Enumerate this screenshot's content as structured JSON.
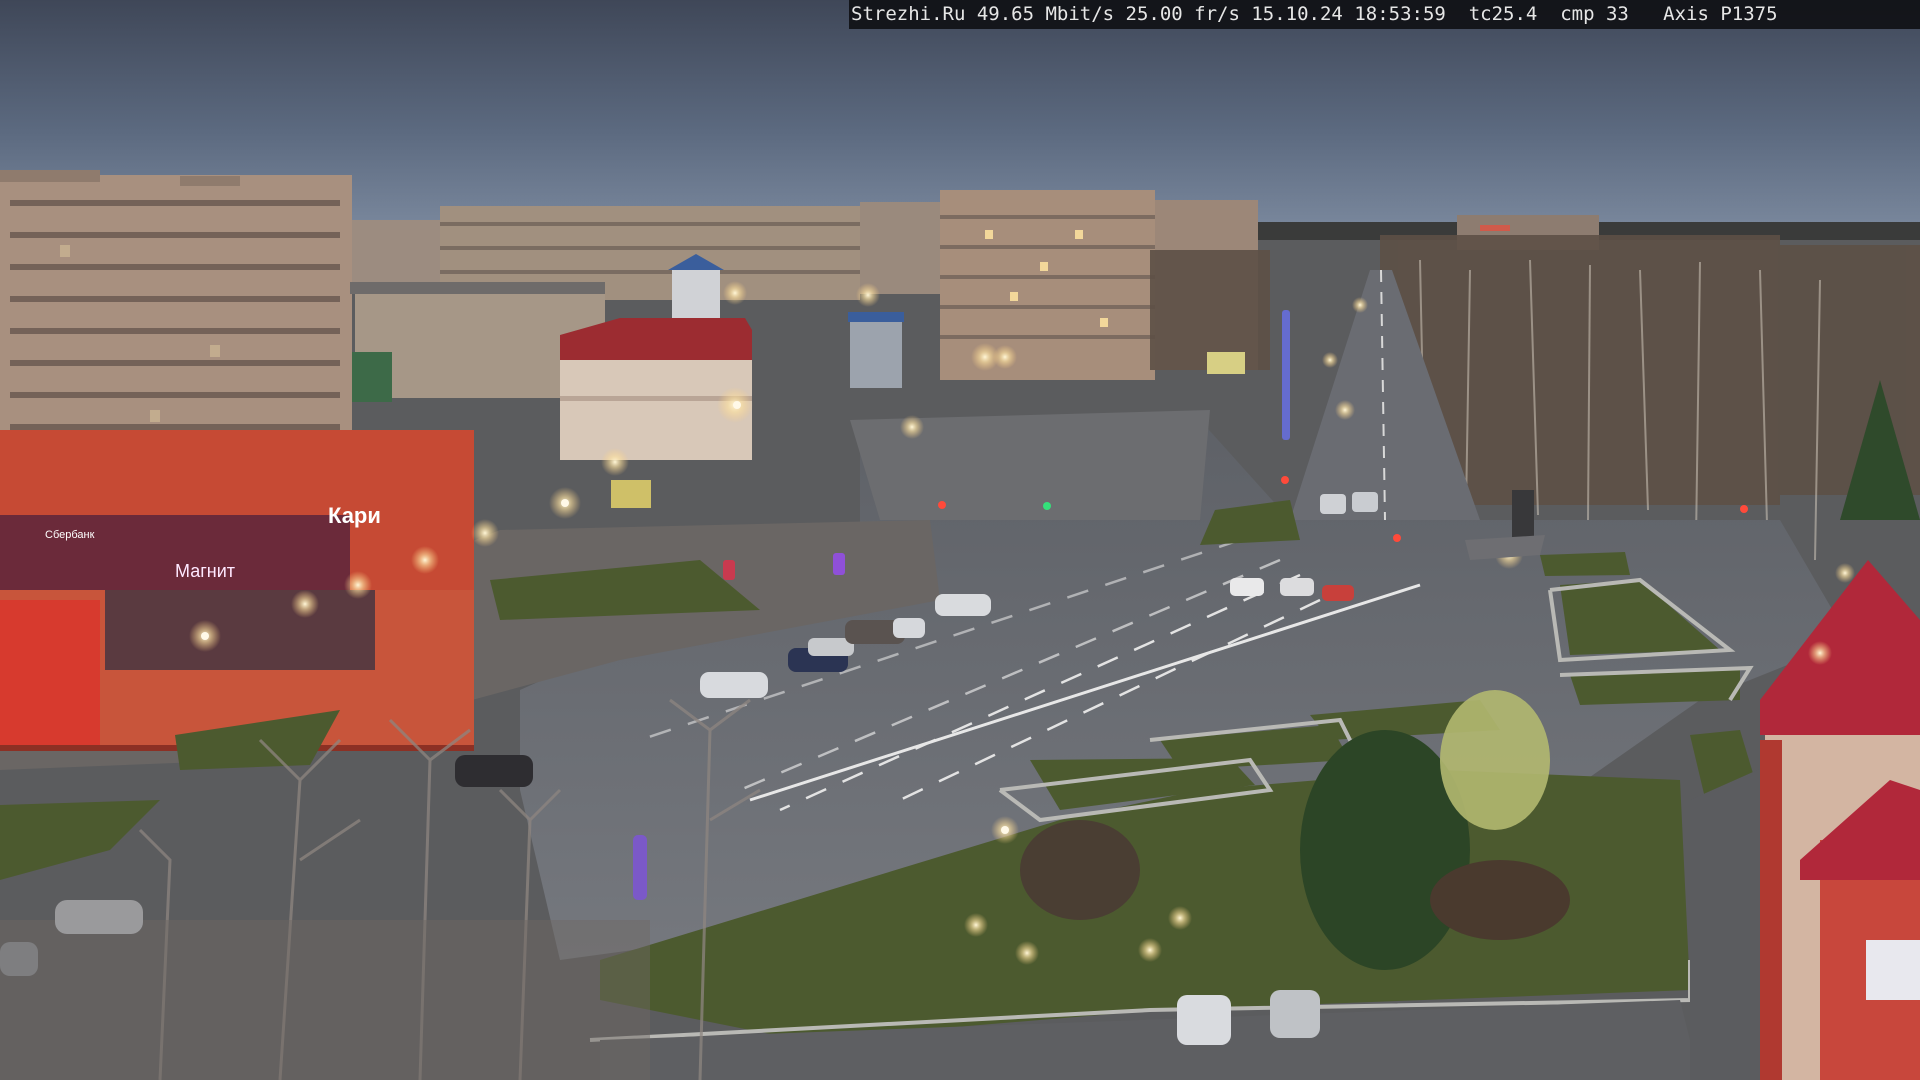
{
  "overlay": {
    "text": "Strezhi.Ru 49.65 Mbit/s 25.00 fr/s 15.10.24 18:53:59  tc25.4  cmp 33   Axis P1375"
  },
  "storefront": {
    "sign_main": "Кари",
    "sign_left": "Магнит",
    "bank_sign": "Сбербанк"
  },
  "colors": {
    "sky_top": "#4b5567",
    "sky_bottom": "#78879c",
    "asphalt": "#6d7077",
    "grass": "#4f5d2e",
    "red_building": "#c94736",
    "brick_panel": "#a78f7f"
  }
}
